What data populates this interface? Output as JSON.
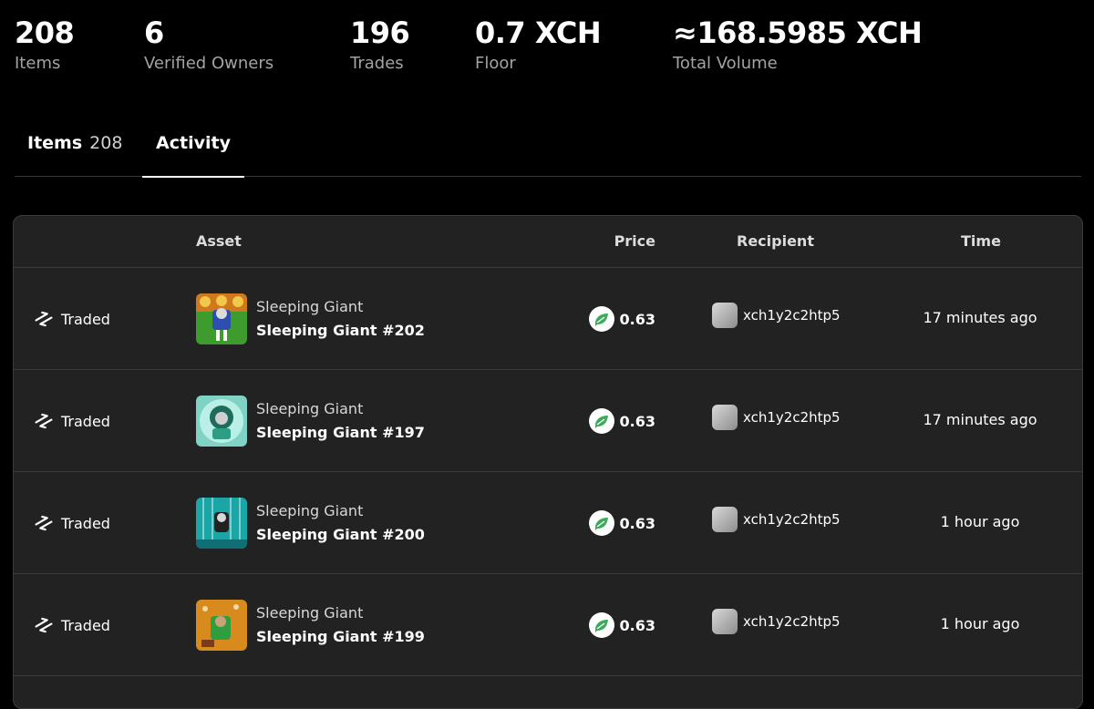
{
  "stats": [
    {
      "value": "208",
      "label": "Items"
    },
    {
      "value": "6",
      "label": "Verified Owners"
    },
    {
      "value": "196",
      "label": "Trades"
    },
    {
      "value": "0.7 XCH",
      "label": "Floor"
    },
    {
      "value": "≈168.5985 XCH",
      "label": "Total Volume"
    }
  ],
  "tabs": [
    {
      "label": "Items",
      "count": "208"
    },
    {
      "label": "Activity",
      "count": ""
    }
  ],
  "table": {
    "headers": {
      "asset": "Asset",
      "price": "Price",
      "recipient": "Recipient",
      "time": "Time"
    },
    "rows": [
      {
        "event": "Traded",
        "collection": "Sleeping Giant",
        "asset": "Sleeping Giant #202",
        "price": "0.63",
        "recipient": "xch1y2c2htp5",
        "time": "17 minutes ago"
      },
      {
        "event": "Traded",
        "collection": "Sleeping Giant",
        "asset": "Sleeping Giant #197",
        "price": "0.63",
        "recipient": "xch1y2c2htp5",
        "time": "17 minutes ago"
      },
      {
        "event": "Traded",
        "collection": "Sleeping Giant",
        "asset": "Sleeping Giant #200",
        "price": "0.63",
        "recipient": "xch1y2c2htp5",
        "time": "1 hour ago"
      },
      {
        "event": "Traded",
        "collection": "Sleeping Giant",
        "asset": "Sleeping Giant #199",
        "price": "0.63",
        "recipient": "xch1y2c2htp5",
        "time": "1 hour ago"
      }
    ]
  },
  "icons": {
    "event": "swap-arrows-icon",
    "currency": "chia-leaf-icon",
    "recipient": "avatar-placeholder"
  },
  "colors": {
    "background": "#000000",
    "panel": "#222222",
    "chia_green": "#3aac59",
    "muted_text": "#a3a3a3"
  }
}
